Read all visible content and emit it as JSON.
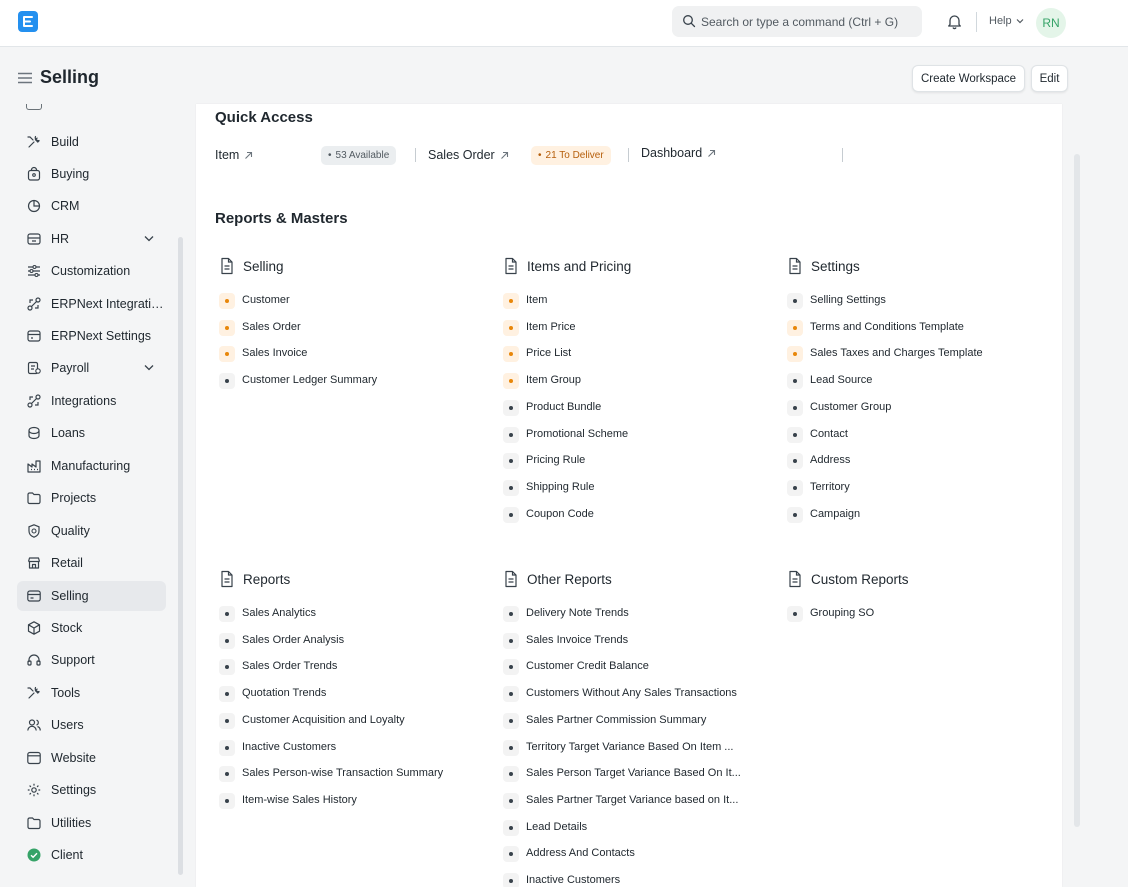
{
  "app": {
    "search_placeholder": "Search or type a command (Ctrl + G)",
    "help_label": "Help",
    "avatar_initials": "RN",
    "accent_color": "#2490ef"
  },
  "page": {
    "title": "Selling",
    "create_workspace_label": "Create Workspace",
    "edit_label": "Edit"
  },
  "sidebar": {
    "items": [
      {
        "label": "Build",
        "icon": "tools-icon",
        "chevron": false
      },
      {
        "label": "Buying",
        "icon": "shopping-bag-icon",
        "chevron": false
      },
      {
        "label": "CRM",
        "icon": "crm-icon",
        "chevron": false
      },
      {
        "label": "HR",
        "icon": "hr-icon",
        "chevron": true
      },
      {
        "label": "Customization",
        "icon": "sliders-icon",
        "chevron": false
      },
      {
        "label": "ERPNext Integrations",
        "icon": "integration-icon",
        "chevron": false
      },
      {
        "label": "ERPNext Settings",
        "icon": "settings-card-icon",
        "chevron": false
      },
      {
        "label": "Payroll",
        "icon": "payroll-icon",
        "chevron": true
      },
      {
        "label": "Integrations",
        "icon": "integration-icon",
        "chevron": false
      },
      {
        "label": "Loans",
        "icon": "loans-icon",
        "chevron": false
      },
      {
        "label": "Manufacturing",
        "icon": "factory-icon",
        "chevron": false
      },
      {
        "label": "Projects",
        "icon": "folder-icon",
        "chevron": false
      },
      {
        "label": "Quality",
        "icon": "shield-icon",
        "chevron": false
      },
      {
        "label": "Retail",
        "icon": "store-icon",
        "chevron": false
      },
      {
        "label": "Selling",
        "icon": "card-icon",
        "chevron": false,
        "active": true
      },
      {
        "label": "Stock",
        "icon": "box-icon",
        "chevron": false
      },
      {
        "label": "Support",
        "icon": "headset-icon",
        "chevron": false
      },
      {
        "label": "Tools",
        "icon": "tools-icon",
        "chevron": false
      },
      {
        "label": "Users",
        "icon": "users-icon",
        "chevron": false
      },
      {
        "label": "Website",
        "icon": "website-icon",
        "chevron": false
      },
      {
        "label": "Settings",
        "icon": "gear-icon",
        "chevron": false
      },
      {
        "label": "Utilities",
        "icon": "folder-icon",
        "chevron": false
      },
      {
        "label": "Client",
        "icon": "check-circle-icon",
        "chevron": false
      }
    ]
  },
  "quick_access": {
    "heading": "Quick Access",
    "shortcuts": [
      {
        "label": "Item",
        "badge": "53 Available",
        "badge_color": "grey"
      },
      {
        "label": "Sales Order",
        "badge": "21 To Deliver",
        "badge_color": "orange"
      },
      {
        "label": "Dashboard"
      }
    ]
  },
  "reports_masters": {
    "heading": "Reports & Masters",
    "sections": [
      {
        "title": "Selling",
        "links": [
          {
            "label": "Customer",
            "color": "orange"
          },
          {
            "label": "Sales Order",
            "color": "orange"
          },
          {
            "label": "Sales Invoice",
            "color": "orange"
          },
          {
            "label": "Customer Ledger Summary",
            "color": "grey"
          }
        ]
      },
      {
        "title": "Items and Pricing",
        "links": [
          {
            "label": "Item",
            "color": "orange"
          },
          {
            "label": "Item Price",
            "color": "orange"
          },
          {
            "label": "Price List",
            "color": "orange"
          },
          {
            "label": "Item Group",
            "color": "orange"
          },
          {
            "label": "Product Bundle",
            "color": "grey"
          },
          {
            "label": "Promotional Scheme",
            "color": "grey"
          },
          {
            "label": "Pricing Rule",
            "color": "grey"
          },
          {
            "label": "Shipping Rule",
            "color": "grey"
          },
          {
            "label": "Coupon Code",
            "color": "grey"
          }
        ]
      },
      {
        "title": "Settings",
        "links": [
          {
            "label": "Selling Settings",
            "color": "grey"
          },
          {
            "label": "Terms and Conditions Template",
            "color": "orange"
          },
          {
            "label": "Sales Taxes and Charges Template",
            "color": "orange"
          },
          {
            "label": "Lead Source",
            "color": "grey"
          },
          {
            "label": "Customer Group",
            "color": "grey"
          },
          {
            "label": "Contact",
            "color": "grey"
          },
          {
            "label": "Address",
            "color": "grey"
          },
          {
            "label": "Territory",
            "color": "grey"
          },
          {
            "label": "Campaign",
            "color": "grey"
          }
        ]
      },
      {
        "title": "Reports",
        "links": [
          {
            "label": "Sales Analytics",
            "color": "grey"
          },
          {
            "label": "Sales Order Analysis",
            "color": "grey"
          },
          {
            "label": "Sales Order Trends",
            "color": "grey"
          },
          {
            "label": "Quotation Trends",
            "color": "grey"
          },
          {
            "label": "Customer Acquisition and Loyalty",
            "color": "grey"
          },
          {
            "label": "Inactive Customers",
            "color": "grey"
          },
          {
            "label": "Sales Person-wise Transaction Summary",
            "color": "grey"
          },
          {
            "label": "Item-wise Sales History",
            "color": "grey"
          }
        ]
      },
      {
        "title": "Other Reports",
        "links": [
          {
            "label": "Delivery Note Trends",
            "color": "grey"
          },
          {
            "label": "Sales Invoice Trends",
            "color": "grey"
          },
          {
            "label": "Customer Credit Balance",
            "color": "grey"
          },
          {
            "label": "Customers Without Any Sales Transactions",
            "color": "grey"
          },
          {
            "label": "Sales Partner Commission Summary",
            "color": "grey"
          },
          {
            "label": "Territory Target Variance Based On Item ...",
            "color": "grey"
          },
          {
            "label": "Sales Person Target Variance Based On It...",
            "color": "grey"
          },
          {
            "label": "Sales Partner Target Variance based on It...",
            "color": "grey"
          },
          {
            "label": "Lead Details",
            "color": "grey"
          },
          {
            "label": "Address And Contacts",
            "color": "grey"
          },
          {
            "label": "Inactive Customers",
            "color": "grey"
          }
        ]
      },
      {
        "title": "Custom Reports",
        "links": [
          {
            "label": "Grouping SO",
            "color": "grey"
          }
        ]
      }
    ]
  }
}
